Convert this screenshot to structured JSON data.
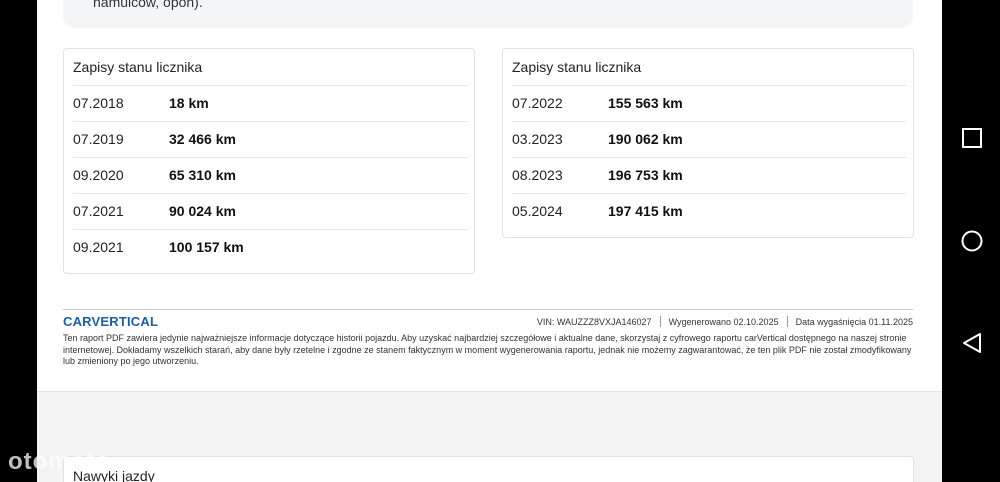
{
  "previous_section": {
    "tail_text": "hamulców, opon)."
  },
  "odometer_left": {
    "title": "Zapisy stanu licznika",
    "rows": [
      {
        "date": "07.2018",
        "km": "18 km"
      },
      {
        "date": "07.2019",
        "km": "32 466 km"
      },
      {
        "date": "09.2020",
        "km": "65 310 km"
      },
      {
        "date": "07.2021",
        "km": "90 024 km"
      },
      {
        "date": "09.2021",
        "km": "100 157 km"
      }
    ]
  },
  "odometer_right": {
    "title": "Zapisy stanu licznika",
    "rows": [
      {
        "date": "07.2022",
        "km": "155 563 km"
      },
      {
        "date": "03.2023",
        "km": "190 062 km"
      },
      {
        "date": "08.2023",
        "km": "196 753 km"
      },
      {
        "date": "05.2024",
        "km": "197 415 km"
      }
    ]
  },
  "footer": {
    "logo": "CARVERTICAL",
    "vin": "VIN:  WAUZZZ8VXJA146027",
    "generated": "Wygenerowano  02.10.2025",
    "expires": "Data wygaśnięcia  01.11.2025",
    "disclaimer": "Ten raport PDF zawiera jedynie najważniejsze informacje dotyczące historii pojazdu. Aby uzyskać najbardziej szczegółowe i aktualne dane, skorzystaj z cyfrowego raportu carVertical dostępnego na naszej stronie internetowej. Dokładamy wszelkich starań, aby dane były rzetelne i zgodne ze stanem faktycznym w moment wygenerowania raportu, jednak nie możemy zagwarantować, że ten plik PDF nie został zmodyfikowany lub zmieniony po jego utworzeniu."
  },
  "next_section": {
    "title": "Nawyki jazdy"
  },
  "watermark": {
    "text": "otomoto"
  },
  "colors": {
    "brand": "#1d5fa8",
    "page_bg": "#f3f3f3",
    "border": "#e2e2e2"
  },
  "nav_icons": [
    "square-recents-icon",
    "circle-home-icon",
    "triangle-back-icon"
  ]
}
